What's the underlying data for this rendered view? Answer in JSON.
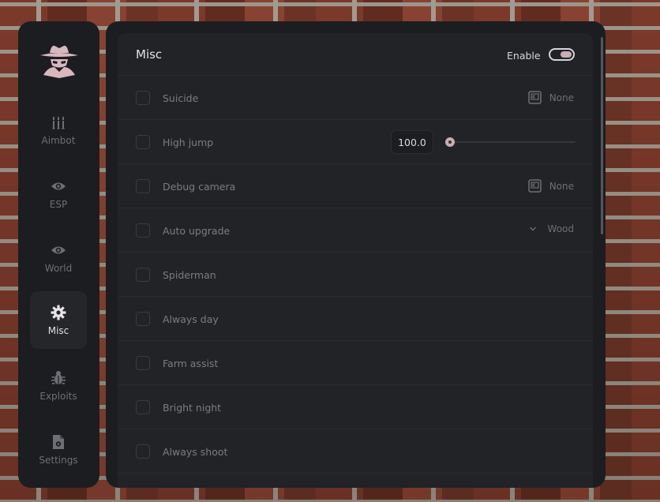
{
  "sidebar": {
    "items": [
      {
        "label": "Aimbot",
        "icon": "bullets-icon",
        "active": false
      },
      {
        "label": "ESP",
        "icon": "eye-icon",
        "active": false
      },
      {
        "label": "World",
        "icon": "eye-icon",
        "active": false
      },
      {
        "label": "Misc",
        "icon": "gear-icon",
        "active": true
      },
      {
        "label": "Exploits",
        "icon": "bug-icon",
        "active": false
      },
      {
        "label": "Settings",
        "icon": "file-settings-icon",
        "active": false
      }
    ]
  },
  "panel": {
    "title": "Misc",
    "enable_label": "Enable",
    "enabled": true
  },
  "rows": [
    {
      "label": "Suicide",
      "control": "keybind",
      "value": "None"
    },
    {
      "label": "High jump",
      "control": "slider",
      "value": "100.0",
      "slider_fraction": 0.0
    },
    {
      "label": "Debug camera",
      "control": "keybind",
      "value": "None"
    },
    {
      "label": "Auto upgrade",
      "control": "dropdown",
      "value": "Wood"
    },
    {
      "label": "Spiderman"
    },
    {
      "label": "Always day"
    },
    {
      "label": "Farm assist"
    },
    {
      "label": "Bright night"
    },
    {
      "label": "Always shoot"
    }
  ],
  "colors": {
    "accent": "#c9aeb4",
    "panel_bg": "#1c1d20",
    "card_bg": "#222326"
  }
}
